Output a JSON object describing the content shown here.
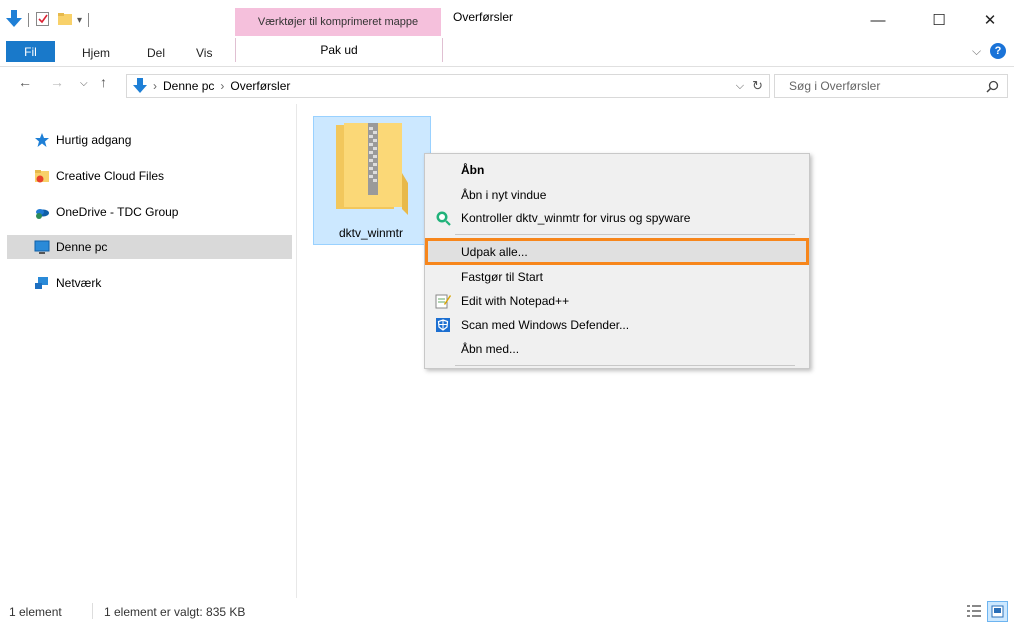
{
  "window": {
    "title": "Overførsler",
    "contextual_tab_header": "Værktøjer til komprimeret mappe",
    "controls": {
      "minimize": "—",
      "maximize": "☐",
      "close": "✕"
    }
  },
  "ribbon": {
    "tabs": [
      "Fil",
      "Hjem",
      "Del",
      "Vis"
    ],
    "contextual_tab": "Pak ud",
    "collapse_glyph": "⌵",
    "help_glyph": "?"
  },
  "address": {
    "breadcrumb": [
      "Denne pc",
      "Overførsler"
    ],
    "separator": "›",
    "search_placeholder": "Søg i Overførsler"
  },
  "nav_pane": {
    "items": [
      {
        "label": "Hurtig adgang",
        "icon": "star-icon"
      },
      {
        "label": "Creative Cloud Files",
        "icon": "creative-cloud-folder-icon"
      },
      {
        "label": "OneDrive - TDC Group",
        "icon": "onedrive-icon"
      },
      {
        "label": "Denne pc",
        "icon": "computer-icon",
        "selected": true
      },
      {
        "label": "Netværk",
        "icon": "network-icon"
      }
    ]
  },
  "files": [
    {
      "name": "dktv_winmtr",
      "icon": "zip-folder-icon",
      "selected": true
    }
  ],
  "context_menu": {
    "items": [
      {
        "label": "Åbn",
        "bold": true
      },
      {
        "label": "Åbn i nyt vindue"
      },
      {
        "label": "Kontroller dktv_winmtr for virus og spyware",
        "icon": "virus-scan-icon"
      },
      {
        "label": "Udpak alle...",
        "highlighted": true
      },
      {
        "label": "Fastgør til Start"
      },
      {
        "label": "Edit with Notepad++",
        "icon": "notepad-plus-plus-icon"
      },
      {
        "label": "Scan med Windows Defender...",
        "icon": "windows-defender-icon"
      },
      {
        "label": "Åbn med..."
      }
    ]
  },
  "status": {
    "count": "1 element",
    "selection": "1 element er valgt: 835 KB"
  },
  "colors": {
    "accent": "#1979ca",
    "highlight_outline": "#f7861b",
    "selection_bg": "#cce8ff",
    "contextual_tab_bg": "#f5c0dc"
  }
}
